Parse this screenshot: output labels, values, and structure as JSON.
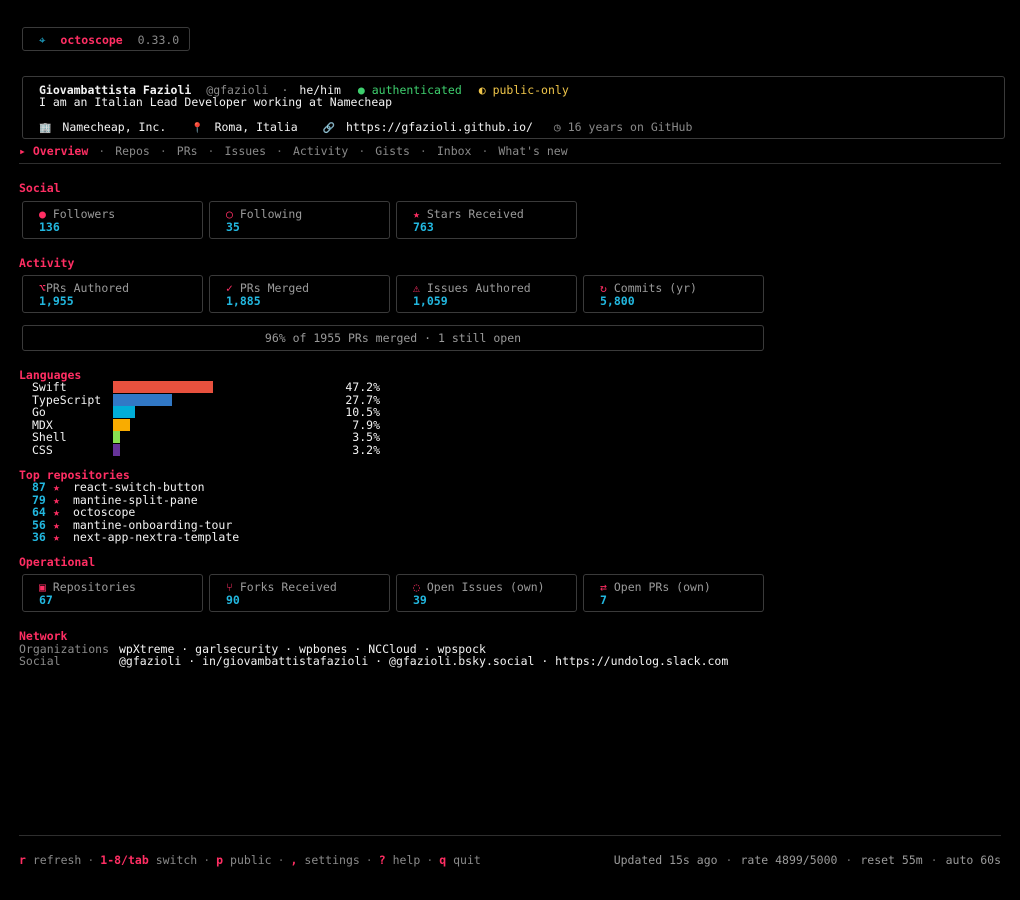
{
  "app": {
    "icon": "⌖",
    "name": "octoscope",
    "version": "0.33.0"
  },
  "profile": {
    "name": "Giovambattista Fazioli",
    "handle": "@gfazioli",
    "pronouns": "he/him",
    "auth_icon": "●",
    "auth_status": "authenticated",
    "scope_icon": "◐",
    "scope": "public-only",
    "bio": "I am an Italian Lead Developer working at Namecheap",
    "company_icon": "🏢",
    "company": "Namecheap, Inc.",
    "location_icon": "📍",
    "location": "Roma, Italia",
    "link_icon": "🔗",
    "website": "https://gfazioli.github.io/",
    "age_icon": "◷",
    "age": "16 years on GitHub"
  },
  "tabs": [
    {
      "label": "Overview",
      "active": true
    },
    {
      "label": "Repos"
    },
    {
      "label": "PRs"
    },
    {
      "label": "Issues"
    },
    {
      "label": "Activity"
    },
    {
      "label": "Gists"
    },
    {
      "label": "Inbox"
    },
    {
      "label": "What's new"
    }
  ],
  "tab_marker": "▸",
  "tab_separator": "·",
  "social": {
    "title": "Social",
    "cards": [
      {
        "icon": "●",
        "label": "Followers",
        "value": "136"
      },
      {
        "icon": "○",
        "label": "Following",
        "value": "35"
      },
      {
        "icon": "★",
        "label": "Stars Received",
        "value": "763"
      }
    ]
  },
  "activity": {
    "title": "Activity",
    "cards": [
      {
        "icon": "⌥",
        "label": "PRs Authored",
        "value": "1,955"
      },
      {
        "icon": "✓",
        "label": "PRs Merged",
        "value": "1,885"
      },
      {
        "icon": "⚠",
        "label": "Issues Authored",
        "value": "1,059"
      },
      {
        "icon": "↻",
        "label": "Commits (yr)",
        "value": "5,800"
      }
    ],
    "merge_summary": "96% of 1955 PRs merged · 1 still open"
  },
  "languages": {
    "title": "Languages",
    "items": [
      {
        "name": "Swift",
        "percent": 47.2,
        "label": "47.2%",
        "color": "#e8513e"
      },
      {
        "name": "TypeScript",
        "percent": 27.7,
        "label": "27.7%",
        "color": "#3178c6"
      },
      {
        "name": "Go",
        "percent": 10.5,
        "label": "10.5%",
        "color": "#00add8"
      },
      {
        "name": "MDX",
        "percent": 7.9,
        "label": "7.9%",
        "color": "#f9ac00"
      },
      {
        "name": "Shell",
        "percent": 3.5,
        "label": "3.5%",
        "color": "#89e051"
      },
      {
        "name": "CSS",
        "percent": 3.2,
        "label": "3.2%",
        "color": "#663399"
      }
    ]
  },
  "top_repos": {
    "title": "Top repositories",
    "star_icon": "★",
    "items": [
      {
        "stars": "87",
        "name": "react-switch-button"
      },
      {
        "stars": "79",
        "name": "mantine-split-pane"
      },
      {
        "stars": "64",
        "name": "octoscope"
      },
      {
        "stars": "56",
        "name": "mantine-onboarding-tour"
      },
      {
        "stars": "36",
        "name": "next-app-nextra-template"
      }
    ]
  },
  "operational": {
    "title": "Operational",
    "cards": [
      {
        "icon": "▣",
        "label": "Repositories",
        "value": "67"
      },
      {
        "icon": "⑂",
        "label": "Forks Received",
        "value": "90"
      },
      {
        "icon": "◌",
        "label": "Open Issues (own)",
        "value": "39"
      },
      {
        "icon": "⇄",
        "label": "Open PRs (own)",
        "value": "7"
      }
    ]
  },
  "network": {
    "title": "Network",
    "organizations_label": "Organizations",
    "organizations": "wpXtreme · garlsecurity · wpbones · NCCloud · wpspock",
    "social_label": "Social",
    "social": "@gfazioli · in/giovambattistafazioli · @gfazioli.bsky.social · https://undolog.slack.com"
  },
  "footer": {
    "shortcuts": [
      {
        "key": "r",
        "label": "refresh"
      },
      {
        "key": "1-8/tab",
        "label": "switch"
      },
      {
        "key": "p",
        "label": "public"
      },
      {
        "key": ",",
        "label": "settings"
      },
      {
        "key": "?",
        "label": "help"
      },
      {
        "key": "q",
        "label": "quit"
      }
    ],
    "updated": "Updated 15s ago",
    "rate": "rate 4899/5000",
    "reset": "reset 55m",
    "auto": "auto 60s"
  },
  "colors": {
    "accent": "#ff2e63",
    "value": "#22b8e0",
    "authenticated": "#3ecf6e",
    "public_only": "#f0c64a"
  }
}
